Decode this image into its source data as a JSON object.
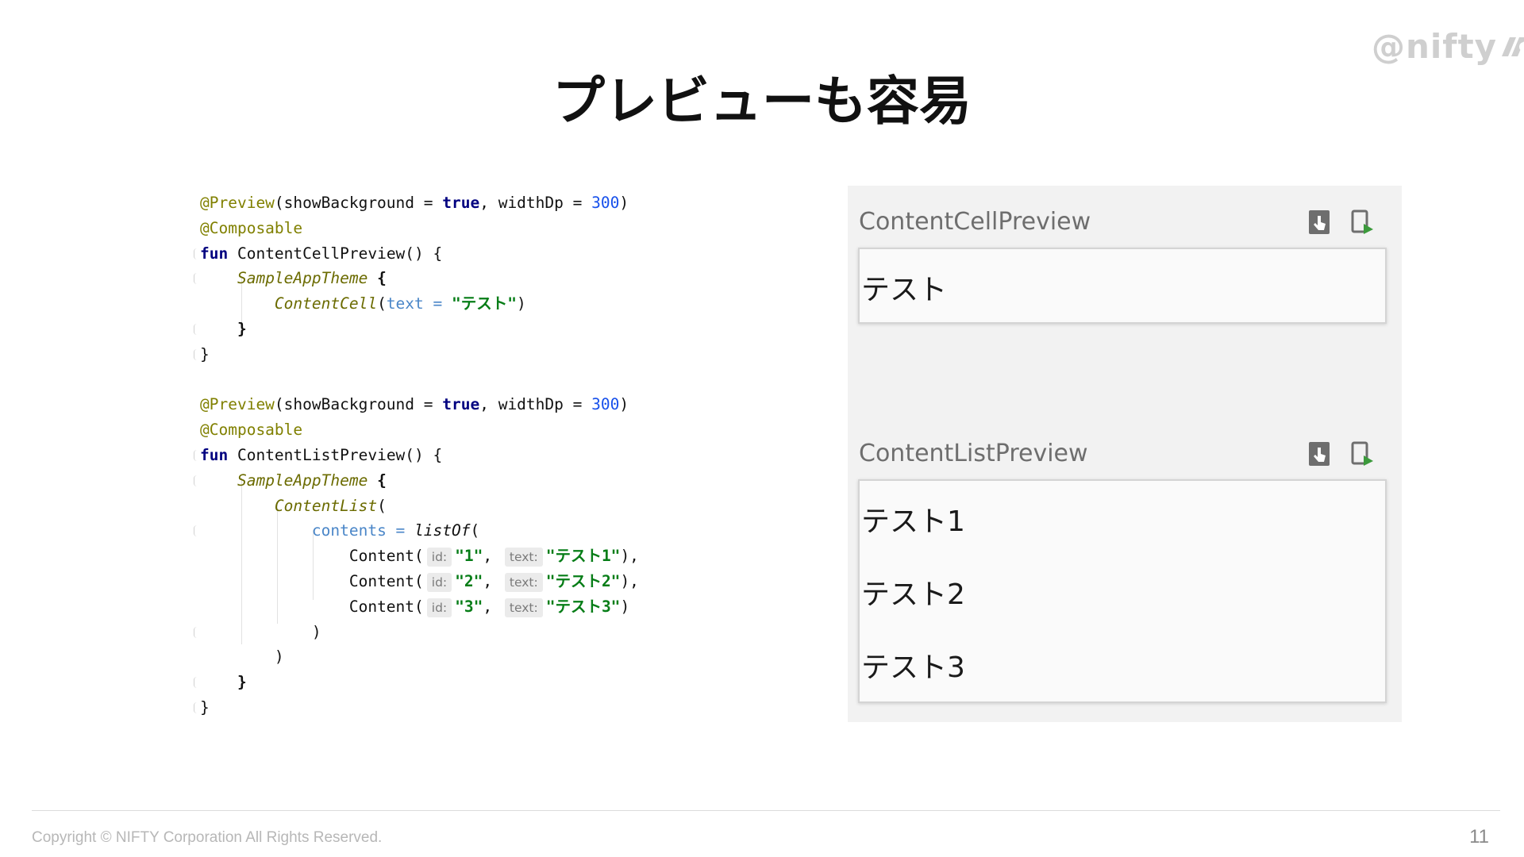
{
  "slide": {
    "logo": "@nifty",
    "title": "プレビューも容易",
    "copyright": "Copyright © NIFTY Corporation All Rights Reserved.",
    "page_number": "11"
  },
  "code": {
    "annotation_preview": "@Preview",
    "preview_args_open": "(showBackground = ",
    "true_kw": "true",
    "width_arg": ", widthDp = ",
    "width_val": "300",
    "close_paren": ")",
    "annotation_composable": "@Composable",
    "fun_kw": "fun",
    "fn_cell": " ContentCellPreview() {",
    "fn_list": " ContentListPreview() {",
    "theme": "SampleAppTheme",
    "brace_open": " {",
    "brace_close": "}",
    "content_cell": "ContentCell",
    "open_paren": "(",
    "text_param": "text = ",
    "cell_text": "\"テスト\"",
    "content_list": "ContentList",
    "contents_param": "contents = ",
    "list_of": "listOf",
    "content_fn": "Content(",
    "id_hint": "id:",
    "text_hint": "text:",
    "comma": ",",
    "row_close": "),",
    "row_close_last": ")",
    "items": [
      {
        "id": "\"1\"",
        "text": "\"テスト1\""
      },
      {
        "id": "\"2\"",
        "text": "\"テスト2\""
      },
      {
        "id": "\"3\"",
        "text": "\"テスト3\""
      }
    ]
  },
  "preview": {
    "cell_title": "ContentCellPreview",
    "cell_text": "テスト",
    "list_title": "ContentListPreview",
    "list_items": [
      "テスト1",
      "テスト2",
      "テスト3"
    ],
    "icons": [
      "interactive-mode-icon",
      "deploy-to-device-icon"
    ]
  },
  "colors": {
    "annotation": "#808000",
    "keyword": "#000080",
    "number": "#1750eb",
    "string": "#067d17",
    "panel_bg": "#f2f2f2"
  }
}
